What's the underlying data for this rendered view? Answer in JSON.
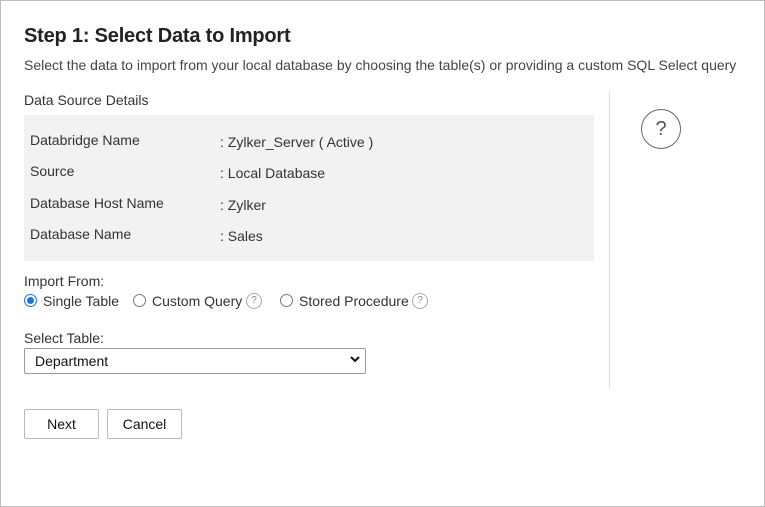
{
  "header": {
    "title": "Step 1: Select Data to Import",
    "subtitle": "Select the data to import from your local database by choosing the table(s) or providing a custom SQL Select query"
  },
  "data_source": {
    "section_title": "Data Source Details",
    "rows": [
      {
        "key": "Databridge Name",
        "value": ": Zylker_Server ( Active )"
      },
      {
        "key": "Source",
        "value": ": Local Database"
      },
      {
        "key": "Database Host Name",
        "value": ": Zylker"
      },
      {
        "key": "Database Name",
        "value": ": Sales"
      }
    ]
  },
  "import_from": {
    "label": "Import From:",
    "options": [
      {
        "label": "Single Table",
        "selected": true
      },
      {
        "label": "Custom Query",
        "selected": false
      },
      {
        "label": "Stored Procedure",
        "selected": false
      }
    ],
    "help_glyph": "?"
  },
  "select_table": {
    "label": "Select Table:",
    "value": "Department"
  },
  "side_help": {
    "glyph": "?",
    "icon": "help-icon"
  },
  "buttons": {
    "next": "Next",
    "cancel": "Cancel"
  },
  "colors": {
    "accent": "#1a73e8",
    "panel_bg": "#f2f2f2",
    "border": "#bdbdbd"
  }
}
